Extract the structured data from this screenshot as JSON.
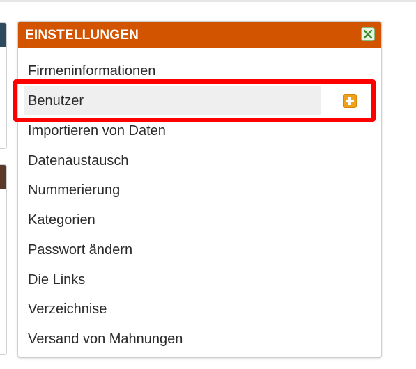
{
  "panel": {
    "title": "EINSTELLUNGEN",
    "header_color": "#d35400",
    "close_icon": "close-icon"
  },
  "menu": {
    "items": [
      {
        "label": "Firmeninformationen"
      },
      {
        "label": "Benutzer",
        "hovered": true,
        "action_icon": "add-icon",
        "highlighted": true
      },
      {
        "label": "Importieren von Daten"
      },
      {
        "label": "Datenaustausch"
      },
      {
        "label": "Nummerierung"
      },
      {
        "label": "Kategorien"
      },
      {
        "label": "Passwort ändern"
      },
      {
        "label": "Die Links"
      },
      {
        "label": "Verzeichnise"
      },
      {
        "label": "Versand von Mahnungen"
      }
    ]
  },
  "annotation": {
    "color": "#ff0000"
  }
}
